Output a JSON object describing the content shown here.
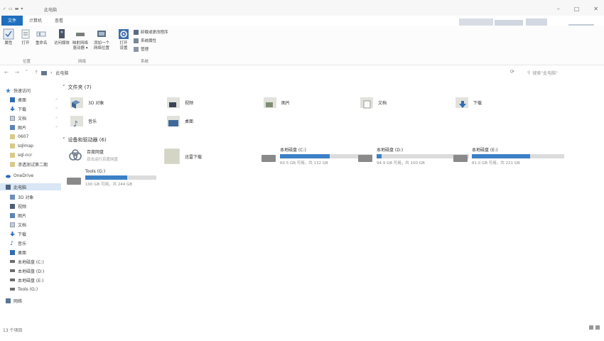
{
  "window": {
    "title": "此电脑"
  },
  "quick_access": [
    "✓",
    "▭",
    "▬",
    "▾"
  ],
  "ribbon": {
    "tabs": [
      "文件",
      "计算机",
      "查看"
    ],
    "buttons": [
      {
        "label": "属性"
      },
      {
        "label": "打开"
      },
      {
        "label": "重命名"
      },
      {
        "label": "访问媒体"
      },
      {
        "label": "映射网络\n驱动器 ▾"
      },
      {
        "label": "添加一个\n网络位置"
      },
      {
        "label": "打开\n设置"
      }
    ],
    "small_buttons": [
      "卸载或更改程序",
      "系统属性",
      "管理"
    ],
    "groups": [
      "位置",
      "网络",
      "系统"
    ]
  },
  "address": {
    "path": "此电脑",
    "search_placeholder": "搜索\"此电脑\""
  },
  "nav": {
    "items": [
      {
        "label": "快速访问",
        "icon": "star-icon"
      },
      {
        "label": "桌面",
        "icon": "desktop-icon",
        "pinned": true
      },
      {
        "label": "下载",
        "icon": "download-icon",
        "pinned": true
      },
      {
        "label": "文档",
        "icon": "document-icon",
        "pinned": true
      },
      {
        "label": "图片",
        "icon": "picture-icon",
        "pinned": true
      },
      {
        "label": "0607",
        "icon": "folder-icon"
      },
      {
        "label": "sqlmap",
        "icon": "folder-icon"
      },
      {
        "label": "sql-ncr",
        "icon": "folder-icon"
      },
      {
        "label": "渗透测试第二期",
        "icon": "folder-icon"
      },
      {
        "label": "OneDrive",
        "icon": "cloud-icon"
      },
      {
        "label": "此电脑",
        "icon": "computer-icon",
        "selected": true
      },
      {
        "label": "3D 对象",
        "icon": "cube-icon"
      },
      {
        "label": "视频",
        "icon": "video-icon"
      },
      {
        "label": "图片",
        "icon": "picture-icon"
      },
      {
        "label": "文档",
        "icon": "document-icon"
      },
      {
        "label": "下载",
        "icon": "download-icon"
      },
      {
        "label": "音乐",
        "icon": "music-icon"
      },
      {
        "label": "桌面",
        "icon": "desktop-icon"
      },
      {
        "label": "本地磁盘 (C:)",
        "icon": "drive-icon"
      },
      {
        "label": "本地磁盘 (D:)",
        "icon": "drive-icon"
      },
      {
        "label": "本地磁盘 (E:)",
        "icon": "drive-icon"
      },
      {
        "label": "Tools (G:)",
        "icon": "drive-icon"
      },
      {
        "label": "网络",
        "icon": "network-icon"
      }
    ]
  },
  "sections": {
    "folders_header": "文件夹 (7)",
    "devices_header": "设备和驱动器 (6)"
  },
  "folders": [
    {
      "name": "3D 对象",
      "icon": "cube-folder-icon"
    },
    {
      "name": "视频",
      "icon": "video-folder-icon"
    },
    {
      "name": "图片",
      "icon": "picture-folder-icon"
    },
    {
      "name": "文档",
      "icon": "document-folder-icon"
    },
    {
      "name": "下载",
      "icon": "download-folder-icon"
    },
    {
      "name": "音乐",
      "icon": "music-folder-icon"
    },
    {
      "name": "桌面",
      "icon": "desktop-folder-icon"
    }
  ],
  "devices": [
    {
      "name": "百度网盘",
      "sub": "双击运行百度网盘",
      "icon": "baidu-netdisk-icon"
    },
    {
      "name": "迅雷下载",
      "icon": "xunlei-folder-icon"
    },
    {
      "name": "本地磁盘 (C:)",
      "free": "60.5 GB 可用，共 132 GB",
      "used_fraction": 0.54
    },
    {
      "name": "本地磁盘 (D:)",
      "free": "94.9 GB 可用，共 100 GB",
      "used_fraction": 0.05
    },
    {
      "name": "本地磁盘 (E:)",
      "free": "81.0 GB 可用，共 221 GB",
      "used_fraction": 0.63
    },
    {
      "name": "Tools (G:)",
      "free": "100 GB 可用，共 244 GB",
      "used_fraction": 0.59
    }
  ],
  "status": {
    "count": "13 个项目"
  },
  "colors": {
    "accent": "#1f6fbf",
    "drive_bar": "#3c80c7",
    "selection": "#d8e6f5"
  }
}
